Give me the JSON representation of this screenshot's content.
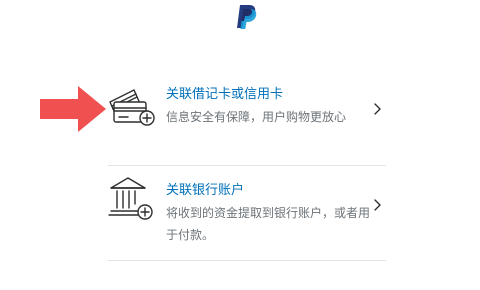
{
  "brand": {
    "logo_icon": "paypal-logo",
    "color_dark": "#253b80",
    "color_light": "#179bd7"
  },
  "pointer": {
    "icon": "arrow-right-icon",
    "color": "#f0504f"
  },
  "options": [
    {
      "icon": "credit-card-add-icon",
      "title": "关联借记卡或信用卡",
      "description": "信息安全有保障，用户购物更放心"
    },
    {
      "icon": "bank-add-icon",
      "title": "关联银行账户",
      "description": "将收到的资金提取到银行账户，或者用于付款。"
    }
  ],
  "accent_color": "#0070ba",
  "chevron_icon": "chevron-right-icon"
}
